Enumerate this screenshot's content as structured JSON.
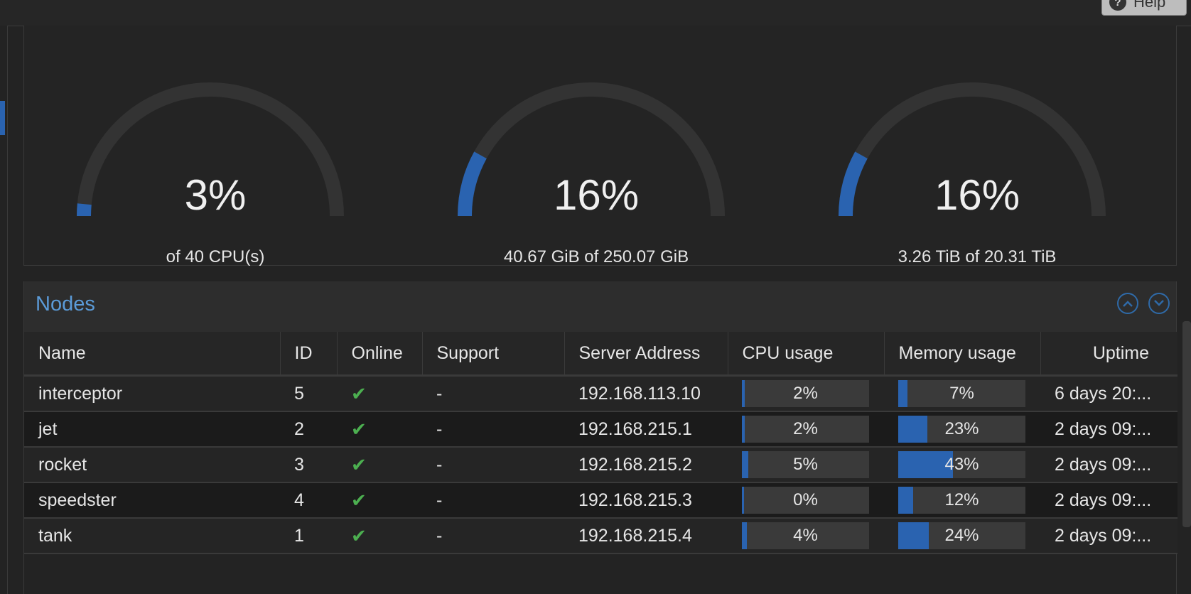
{
  "help": {
    "label": "Help"
  },
  "gauges": [
    {
      "percent_label": "3%",
      "value": 0.03,
      "subtitle": "of 40 CPU(s)"
    },
    {
      "percent_label": "16%",
      "value": 0.16,
      "subtitle": "40.67 GiB of 250.07 GiB"
    },
    {
      "percent_label": "16%",
      "value": 0.16,
      "subtitle": "3.26 TiB of 20.31 TiB"
    }
  ],
  "nodes": {
    "title": "Nodes",
    "columns": [
      "Name",
      "ID",
      "Online",
      "Support",
      "Server Address",
      "CPU usage",
      "Memory usage",
      "Uptime"
    ],
    "rows": [
      {
        "name": "interceptor",
        "id": "5",
        "online": true,
        "support": "-",
        "address": "192.168.113.10",
        "cpu": "2%",
        "cpu_value": 0.02,
        "mem": "7%",
        "mem_value": 0.07,
        "uptime": "6 days 20:..."
      },
      {
        "name": "jet",
        "id": "2",
        "online": true,
        "support": "-",
        "address": "192.168.215.1",
        "cpu": "2%",
        "cpu_value": 0.02,
        "mem": "23%",
        "mem_value": 0.23,
        "uptime": "2 days 09:..."
      },
      {
        "name": "rocket",
        "id": "3",
        "online": true,
        "support": "-",
        "address": "192.168.215.2",
        "cpu": "5%",
        "cpu_value": 0.05,
        "mem": "43%",
        "mem_value": 0.43,
        "uptime": "2 days 09:..."
      },
      {
        "name": "speedster",
        "id": "4",
        "online": true,
        "support": "-",
        "address": "192.168.215.3",
        "cpu": "0%",
        "cpu_value": 0.0,
        "mem": "12%",
        "mem_value": 0.12,
        "uptime": "2 days 09:..."
      },
      {
        "name": "tank",
        "id": "1",
        "online": true,
        "support": "-",
        "address": "192.168.215.4",
        "cpu": "4%",
        "cpu_value": 0.04,
        "mem": "24%",
        "mem_value": 0.24,
        "uptime": "2 days 09:..."
      }
    ]
  },
  "colors": {
    "accent": "#2a63b0",
    "title": "#5b9bd8",
    "check": "#4caf50",
    "track": "#333333"
  }
}
